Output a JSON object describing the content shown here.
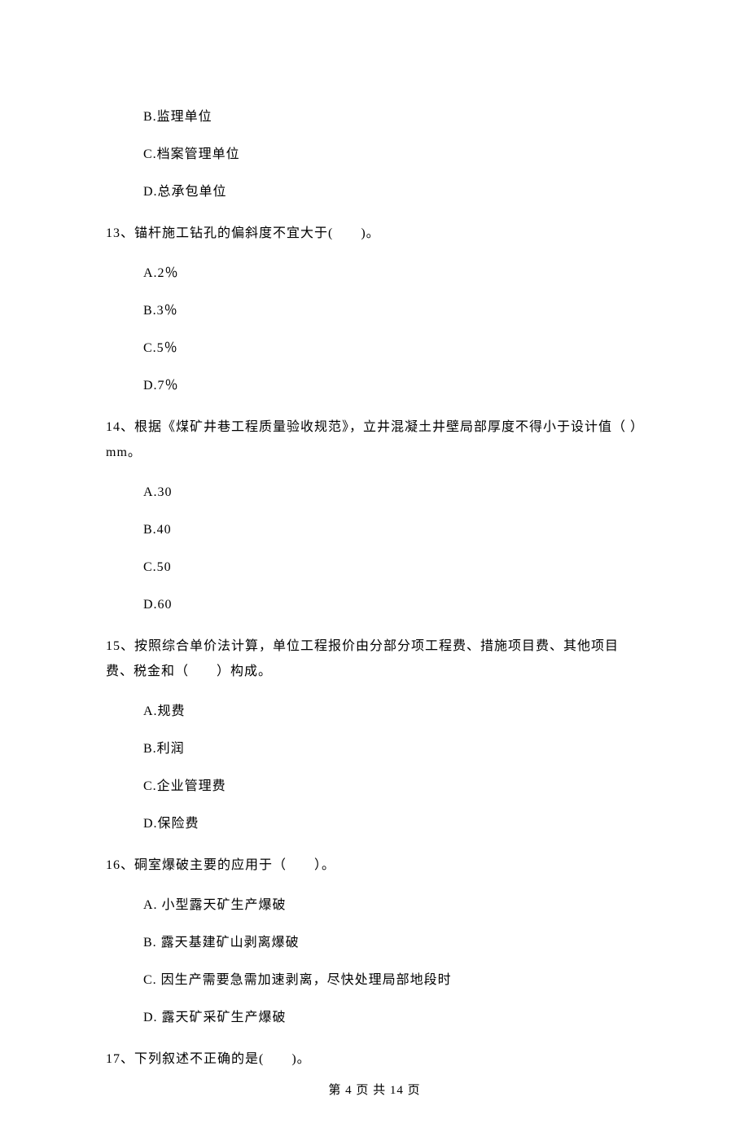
{
  "q12_prev_options": {
    "b": "B.监理单位",
    "c": "C.档案管理单位",
    "d": "D.总承包单位"
  },
  "q13": {
    "stem": "13、锚杆施工钻孔的偏斜度不宜大于(　　)。",
    "a": "A.2％",
    "b": "B.3％",
    "c": "C.5％",
    "d": "D.7％"
  },
  "q14": {
    "stem": "14、根据《煤矿井巷工程质量验收规范》，立井混凝土井壁局部厚度不得小于设计值（ ）mm。",
    "a": "A.30",
    "b": "B.40",
    "c": "C.50",
    "d": "D.60"
  },
  "q15": {
    "stem": "15、按照综合单价法计算，单位工程报价由分部分项工程费、措施项目费、其他项目费、税金和（　　）构成。",
    "a": "A.规费",
    "b": "B.利润",
    "c": "C.企业管理费",
    "d": "D.保险费"
  },
  "q16": {
    "stem": "16、硐室爆破主要的应用于（　　）。",
    "a": "A. 小型露天矿生产爆破",
    "b": "B. 露天基建矿山剥离爆破",
    "c": "C. 因生产需要急需加速剥离，尽快处理局部地段时",
    "d": "D. 露天矿采矿生产爆破"
  },
  "q17": {
    "stem": "17、下列叙述不正确的是(　　)。"
  },
  "footer": "第 4 页 共 14 页"
}
